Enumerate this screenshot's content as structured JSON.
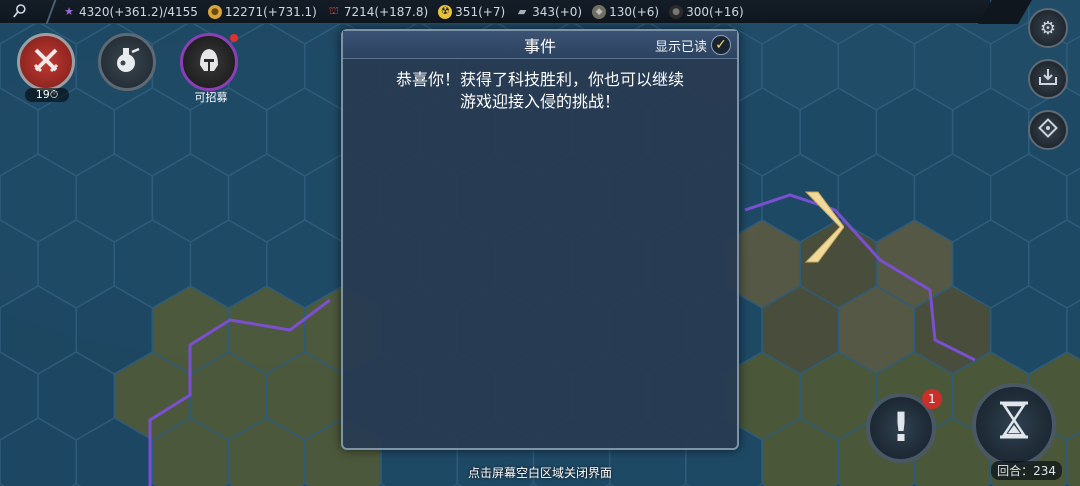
{
  "topbar": {
    "resources": [
      {
        "icon": "star-icon",
        "color": "#9a6ad8",
        "text": "4320(+361.2)/4155"
      },
      {
        "icon": "coin-icon",
        "color": "#d9a43a",
        "text": "12271(+731.1)"
      },
      {
        "icon": "food-icon",
        "color": "#d23a30",
        "text": "7214(+187.8)"
      },
      {
        "icon": "radiation-icon",
        "color": "#e8c33a",
        "text": "351(+7)"
      },
      {
        "icon": "steel-icon",
        "color": "#a8b0b8",
        "text": "343(+0)"
      },
      {
        "icon": "ore-icon",
        "color": "#8a8a7a",
        "text": "130(+6)"
      },
      {
        "icon": "oil-icon",
        "color": "#3a3a3a",
        "text": "300(+16)"
      }
    ]
  },
  "left_buttons": {
    "combat_counter": "19",
    "recruit_label": "可招募"
  },
  "dialog": {
    "title": "事件",
    "show_read_label": "显示已读",
    "message_line1": "恭喜你！获得了科技胜利，你也可以继续",
    "message_line2": "游戏迎接入侵的挑战！"
  },
  "bottom": {
    "hint": "点击屏幕空白区域关闭界面",
    "alert_badge": "1",
    "alert_symbol": "!",
    "turn_label": "回合：",
    "turn_value": "234"
  },
  "colors": {
    "dialog_bg": "#283a52",
    "accent_purple": "#8a3fb5",
    "territory_purple": "#7a4fd0",
    "alert_red": "#c9302a"
  }
}
